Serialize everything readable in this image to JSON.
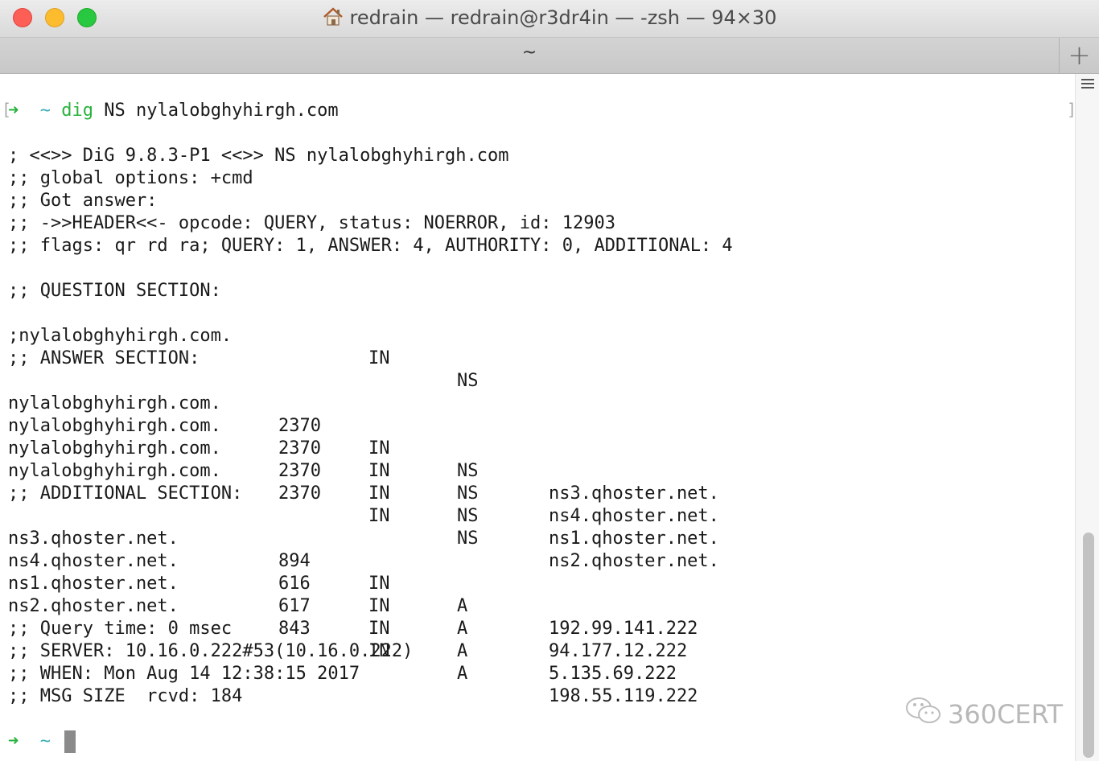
{
  "window": {
    "title": "redrain — redrain@r3dr4in — -zsh — 94×30",
    "tab_label": "~",
    "new_tab_label": "+"
  },
  "prompt": {
    "arrow": "➜",
    "tilde": "~",
    "command_name": "dig",
    "command_args": " NS nylalobghyhirgh.com"
  },
  "output": {
    "header_lines": [
      "; <<>> DiG 9.8.3-P1 <<>> NS nylalobghyhirgh.com",
      ";; global options: +cmd",
      ";; Got answer:",
      ";; ->>HEADER<<- opcode: QUERY, status: NOERROR, id: 12903",
      ";; flags: qr rd ra; QUERY: 1, ANSWER: 4, AUTHORITY: 0, ADDITIONAL: 4"
    ],
    "question_header": ";; QUESTION SECTION:",
    "question_row": {
      "name": ";nylalobghyhirgh.com.",
      "ttl": "",
      "class": "IN",
      "type": "NS",
      "data": ""
    },
    "answer_header": ";; ANSWER SECTION:",
    "answer_rows": [
      {
        "name": "nylalobghyhirgh.com.",
        "ttl": "2370",
        "class": "IN",
        "type": "NS",
        "data": "ns3.qhoster.net."
      },
      {
        "name": "nylalobghyhirgh.com.",
        "ttl": "2370",
        "class": "IN",
        "type": "NS",
        "data": "ns4.qhoster.net."
      },
      {
        "name": "nylalobghyhirgh.com.",
        "ttl": "2370",
        "class": "IN",
        "type": "NS",
        "data": "ns1.qhoster.net."
      },
      {
        "name": "nylalobghyhirgh.com.",
        "ttl": "2370",
        "class": "IN",
        "type": "NS",
        "data": "ns2.qhoster.net."
      }
    ],
    "additional_header": ";; ADDITIONAL SECTION:",
    "additional_rows": [
      {
        "name": "ns3.qhoster.net.",
        "ttl": "894",
        "class": "IN",
        "type": "A",
        "data": "192.99.141.222"
      },
      {
        "name": "ns4.qhoster.net.",
        "ttl": "616",
        "class": "IN",
        "type": "A",
        "data": "94.177.12.222"
      },
      {
        "name": "ns1.qhoster.net.",
        "ttl": "617",
        "class": "IN",
        "type": "A",
        "data": "5.135.69.222"
      },
      {
        "name": "ns2.qhoster.net.",
        "ttl": "843",
        "class": "IN",
        "type": "A",
        "data": "198.55.119.222"
      }
    ],
    "footer_lines": [
      ";; Query time: 0 msec",
      ";; SERVER: 10.16.0.222#53(10.16.0.222)",
      ";; WHEN: Mon Aug 14 12:38:15 2017",
      ";; MSG SIZE  rcvd: 184"
    ]
  },
  "watermark": {
    "text": "360CERT",
    "icon": "wechat-icon"
  },
  "colors": {
    "prompt_arrow": "#28b23c",
    "prompt_tilde": "#3aaeb5",
    "command": "#28b23c",
    "text": "#1a1a1a"
  }
}
